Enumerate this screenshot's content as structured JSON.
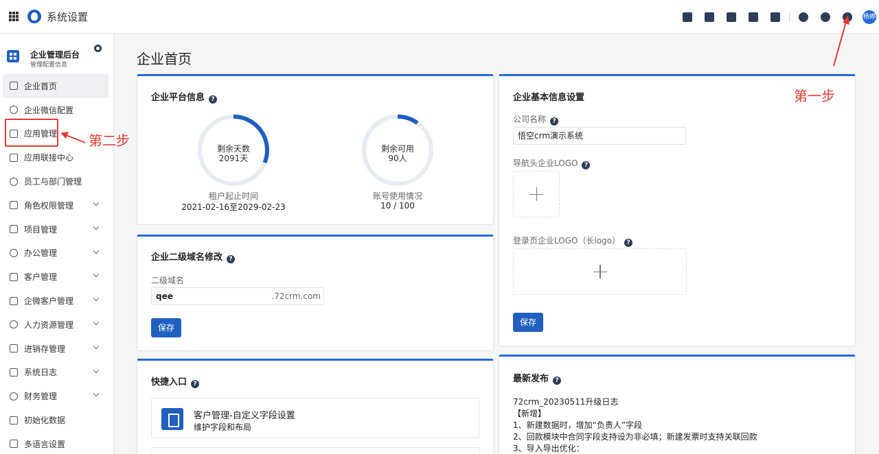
{
  "topbar": {
    "title": "系统设置",
    "avatar": "杨婷",
    "icons": [
      "grid-menu-icon",
      "app-logo-icon",
      "task-icon",
      "contacts-icon",
      "document-icon",
      "phone-book-icon",
      "calendar-icon",
      "bell-icon",
      "help-icon",
      "gear-icon"
    ]
  },
  "sidebar": {
    "title": "企业管理后台",
    "subtitle": "管理配置信息",
    "items": [
      {
        "label": "企业首页",
        "icon": "home-icon",
        "active": true,
        "expandable": false
      },
      {
        "label": "企业微信配置",
        "icon": "wechat-icon",
        "active": false,
        "expandable": false
      },
      {
        "label": "应用管理",
        "icon": "apps-icon",
        "active": false,
        "expandable": false
      },
      {
        "label": "应用联接中心",
        "icon": "bulb-icon",
        "active": false,
        "expandable": false
      },
      {
        "label": "员工与部门管理",
        "icon": "users-icon",
        "active": false,
        "expandable": false
      },
      {
        "label": "角色权限管理",
        "icon": "role-icon",
        "active": false,
        "expandable": true
      },
      {
        "label": "项目管理",
        "icon": "folder-icon",
        "active": false,
        "expandable": true
      },
      {
        "label": "办公管理",
        "icon": "briefcase-icon",
        "active": false,
        "expandable": true
      },
      {
        "label": "客户管理",
        "icon": "customer-icon",
        "active": false,
        "expandable": true
      },
      {
        "label": "企微客户管理",
        "icon": "wechat-customer-icon",
        "active": false,
        "expandable": true
      },
      {
        "label": "人力资源管理",
        "icon": "person-icon",
        "active": false,
        "expandable": true
      },
      {
        "label": "进销存管理",
        "icon": "box-icon",
        "active": false,
        "expandable": true
      },
      {
        "label": "系统日志",
        "icon": "log-icon",
        "active": false,
        "expandable": true
      },
      {
        "label": "财务管理",
        "icon": "finance-icon",
        "active": false,
        "expandable": true
      },
      {
        "label": "初始化数据",
        "icon": "init-icon",
        "active": false,
        "expandable": false
      },
      {
        "label": "多语言设置",
        "icon": "language-icon",
        "active": false,
        "expandable": false
      }
    ]
  },
  "main": {
    "page_title": "企业首页",
    "platform": {
      "title": "企业平台信息",
      "days_label": "剩余天数",
      "days_value": "2091天",
      "days_fraction": 0.31,
      "tenant_caption": "租户起止时间",
      "tenant_range": "2021-02-16至2029-02-23",
      "seats_label": "剩余可用",
      "seats_value": "90人",
      "seats_fraction": 0.1,
      "usage_caption": "账号使用情况",
      "usage_value": "10 / 100"
    },
    "domain": {
      "title": "企业二级域名修改",
      "label": "二级域名",
      "value": "qee",
      "suffix": ".72crm.com",
      "save": "保存"
    },
    "basic": {
      "title": "企业基本信息设置",
      "company_label": "公司名称",
      "company_value": "悟空crm演示系统",
      "nav_logo_label": "导航头企业LOGO",
      "login_logo_label": "登录页企业LOGO（长logo）",
      "save": "保存"
    },
    "quick": {
      "title": "快捷入口",
      "entry_title": "客户管理-自定义字段设置",
      "entry_sub": "维护字段和布局"
    },
    "release": {
      "title": "最新发布",
      "lines": [
        "72crm_20230511升级日志",
        "【新增】",
        "1、新建数据时，增加“负责人”字段",
        "2、回款模块中合同字段支持设为非必填；新建发票时支持关联回款",
        "3、导入导出优化："
      ]
    }
  },
  "annotations": {
    "step1": "第一步",
    "step2": "第二步",
    "color": "#e53935"
  },
  "colors": {
    "accent": "#2469d6",
    "button": "#1f5fbf"
  }
}
